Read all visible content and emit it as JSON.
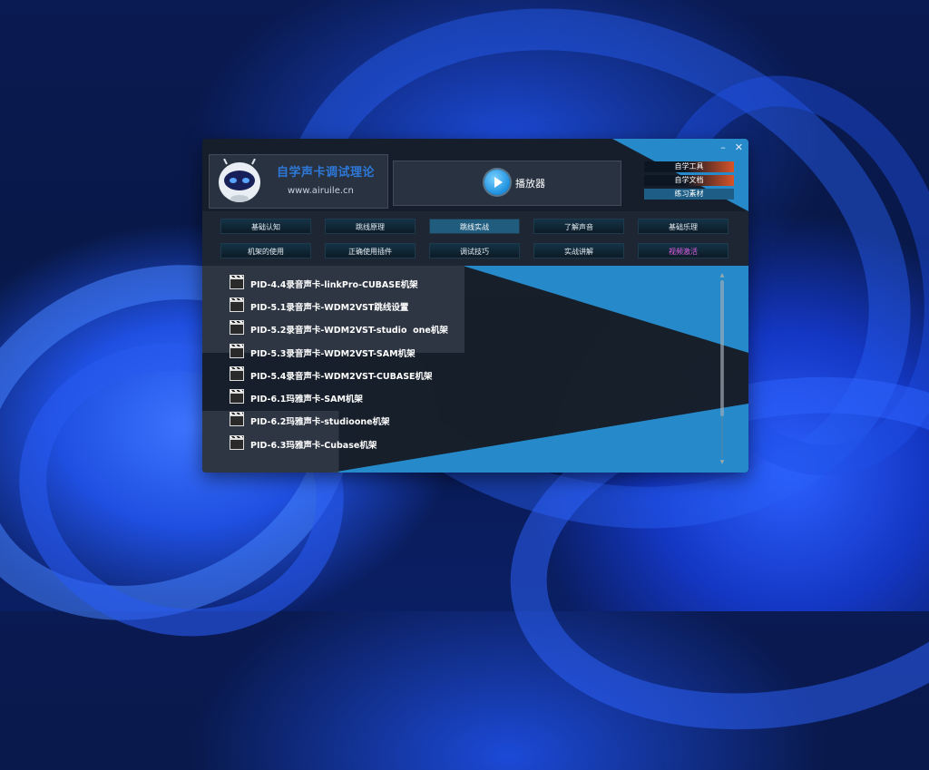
{
  "window": {
    "controls": {
      "minimize": "–",
      "close": "✕"
    },
    "logo": {
      "title": "自学声卡调试理论",
      "url": "www.airuile.cn"
    },
    "player": {
      "label": "播放器",
      "icon": "play-icon"
    },
    "side_links": [
      "自学工具",
      "自学文档",
      "练习素材"
    ],
    "nav_rows": [
      [
        "基础认知",
        "跳线原理",
        "跳线实战",
        "了解声音",
        "基础乐理"
      ],
      [
        "机架的使用",
        "正确使用插件",
        "调试技巧",
        "实战讲解",
        "视频激活"
      ]
    ],
    "nav_active": "跳线实战",
    "list_items": [
      "PID-4.4录音声卡-linkPro-CUBASE机架",
      "PID-5.1录音声卡-WDM2VST跳线设置",
      "PID-5.2录音声卡-WDM2VST-studio  one机架",
      "PID-5.3录音声卡-WDM2VST-SAM机架",
      "PID-5.4录音声卡-WDM2VST-CUBASE机架",
      "PID-6.1玛雅声卡-SAM机架",
      "PID-6.2玛雅声卡-studioone机架",
      "PID-6.3玛雅声卡-Cubase机架"
    ],
    "colors": {
      "accent_blue": "#2896dc",
      "link_orange": "#d8542a",
      "highlight_pink": "#e060e8",
      "logo_title_blue": "#2d78d8"
    }
  }
}
